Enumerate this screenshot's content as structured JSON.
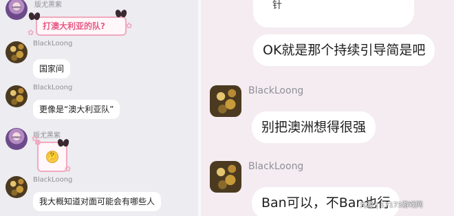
{
  "left_chat": {
    "sender_1": "版尤黑紫",
    "sticker_1_text": "打澳大利亚的队?",
    "sender_2": "BlackLoong",
    "msg_1": "国家间",
    "sender_3": "BlackLoong",
    "msg_2": "更像是“澳大利亚队”",
    "sender_4": "版尤黑紫",
    "sticker_2_emoji": "🤔",
    "sender_5": "BlackLoong",
    "msg_3": "我大概知道对面可能会有哪些人"
  },
  "right_chat": {
    "msg_top_fragment": "针",
    "msg_1": "OK就是那个持续引导简是吧",
    "sender_1": "BlackLoong",
    "msg_2": "别把澳洲想得很强",
    "sender_2": "BlackLoong",
    "msg_3": "Ban可以，不Ban也行"
  },
  "watermark": "九游 | 17173游戏网",
  "icons": [
    "avatar-anime",
    "avatar-gold",
    "bow-icon",
    "flower-icon",
    "thinking-emoji-icon"
  ],
  "colors": {
    "left_bg": "#ececf1",
    "right_bg": "#f4ecf1",
    "bubble": "#ffffff",
    "sticker_border": "#f1a9bf",
    "sticker_text": "#e75a86"
  }
}
